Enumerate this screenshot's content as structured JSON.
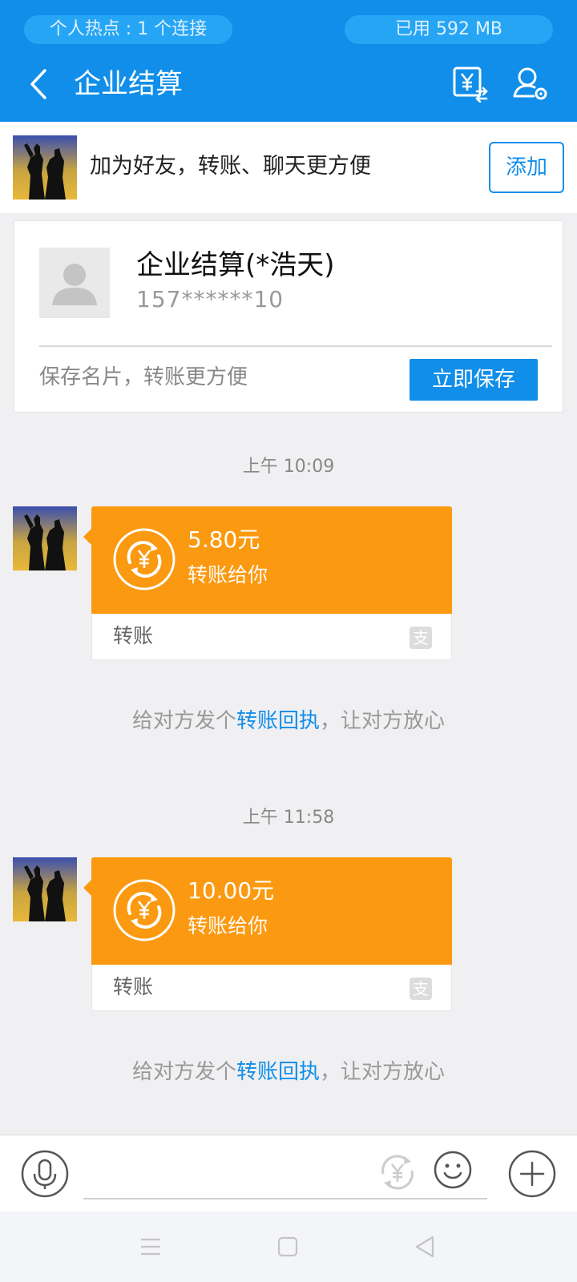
{
  "status": {
    "hotspot": "个人热点 : 1 个连接",
    "data_used": "已用 592 MB"
  },
  "header": {
    "title": "企业结算"
  },
  "add_friend": {
    "text": "加为好友，转账、聊天更方便",
    "button": "添加"
  },
  "contact_card": {
    "name": "企业结算(*浩天)",
    "phone": "157******10",
    "hint": "保存名片，转账更方便",
    "save_button": "立即保存"
  },
  "messages": [
    {
      "time": "上午 10:09",
      "amount": "5.80元",
      "subtitle": "转账给你",
      "footer": "转账",
      "receipt_prefix": "给对方发个",
      "receipt_link": "转账回执",
      "receipt_suffix": "，让对方放心"
    },
    {
      "time": "上午 11:58",
      "amount": "10.00元",
      "subtitle": "转账给你",
      "footer": "转账",
      "receipt_prefix": "给对方发个",
      "receipt_link": "转账回执",
      "receipt_suffix": "，让对方放心"
    }
  ],
  "zhi_glyph": "支",
  "colors": {
    "brand_blue": "#108ee9",
    "transfer_orange": "#fb9910",
    "background": "#f0f0f2"
  }
}
